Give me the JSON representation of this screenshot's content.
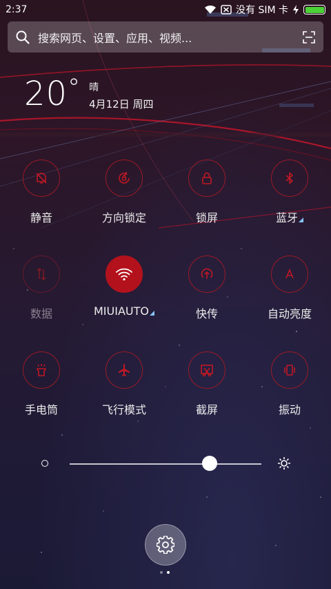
{
  "status_bar": {
    "time": "2:37",
    "carrier_text": "没有 SIM 卡",
    "battery_level": 1.0,
    "battery_color": "#4cd137"
  },
  "search": {
    "placeholder": "搜索网页、设置、应用、视频...",
    "icon": "search-icon",
    "scan_icon": "scan-icon"
  },
  "weather": {
    "temperature": "20",
    "degree_symbol": "°",
    "condition": "晴",
    "date": "4月12日 周四"
  },
  "toggles": [
    {
      "label": "静音",
      "icon": "bell-off-icon",
      "state": "off"
    },
    {
      "label": "方向锁定",
      "icon": "rotation-lock-icon",
      "state": "off"
    },
    {
      "label": "锁屏",
      "icon": "lock-icon",
      "state": "off"
    },
    {
      "label": "蓝牙",
      "icon": "bluetooth-icon",
      "state": "off",
      "expandable": true
    },
    {
      "label": "数据",
      "icon": "mobile-data-icon",
      "state": "disabled"
    },
    {
      "label": "MIUIAUTO",
      "icon": "wifi-icon",
      "state": "on",
      "expandable": true
    },
    {
      "label": "快传",
      "icon": "quick-share-icon",
      "state": "off"
    },
    {
      "label": "自动亮度",
      "icon": "auto-brightness-icon",
      "state": "off"
    },
    {
      "label": "手电筒",
      "icon": "flashlight-icon",
      "state": "off"
    },
    {
      "label": "飞行模式",
      "icon": "airplane-icon",
      "state": "off"
    },
    {
      "label": "截屏",
      "icon": "screenshot-icon",
      "state": "off"
    },
    {
      "label": "振动",
      "icon": "vibrate-icon",
      "state": "off"
    }
  ],
  "brightness": {
    "level": 0.73
  },
  "colors": {
    "accent": "#b3121d",
    "expand_marker": "#86c5ff"
  },
  "pager": {
    "pages": 2,
    "current": 2
  }
}
